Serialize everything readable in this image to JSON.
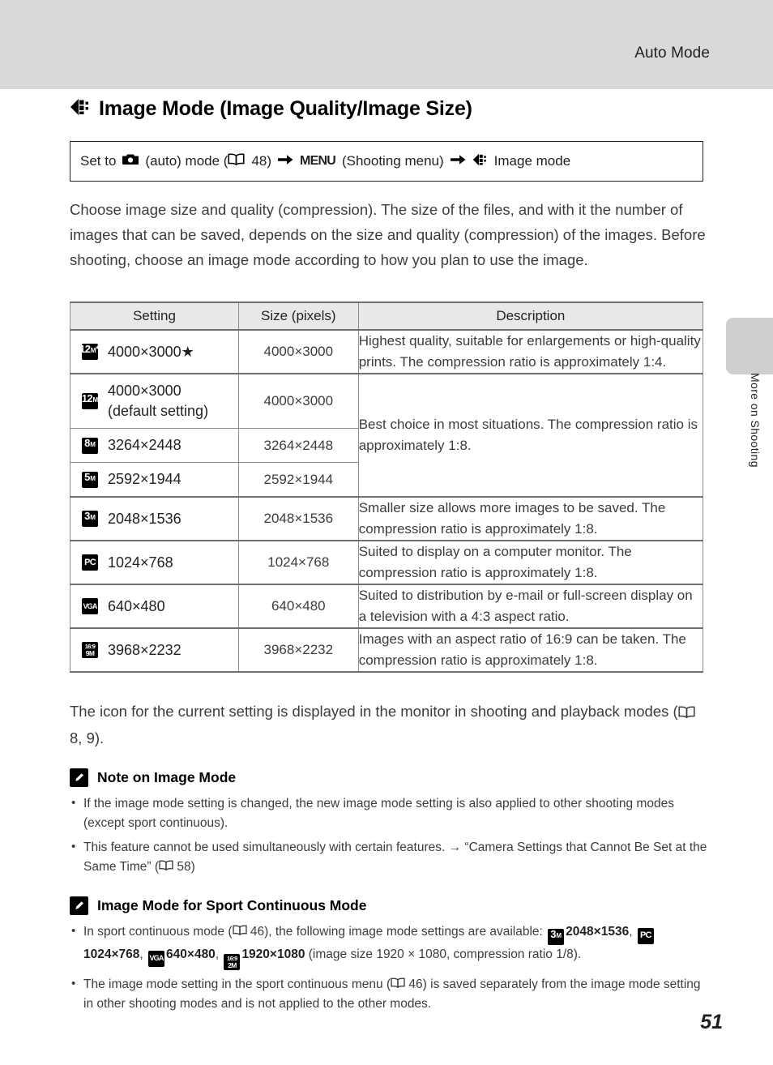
{
  "header": {
    "running_title": "Auto Mode"
  },
  "side_tab": {
    "label": "More on Shooting"
  },
  "section": {
    "icon": "image-mode-icon",
    "title": "Image Mode (Image Quality/Image Size)"
  },
  "route": {
    "set_to": "Set to",
    "camera_icon": "camera-auto-icon",
    "auto_mode": "(auto) mode (",
    "book_icon": "book-reference-icon",
    "page_ref_1": "48)",
    "arrow1": "➔",
    "menu": "MENU",
    "shooting_menu": "(Shooting menu)",
    "arrow2": "➔",
    "image_mode_icon": "image-mode-icon",
    "image_mode": "Image mode"
  },
  "intro": "Choose image size and quality (compression). The size of the files, and with it the number of images that can be saved, depends on the size and quality (compression) of the images. Before shooting, choose an image mode according to how you plan to use the image.",
  "table": {
    "headers": [
      "Setting",
      "Size (pixels)",
      "Description"
    ],
    "rows": [
      {
        "icon": "12m-fine-icon",
        "icon_big": "12",
        "icon_small": "M",
        "icon_star": "★",
        "setting": "4000×3000★",
        "size": "4000×3000",
        "description": "Highest quality, suitable for enlargements or high-quality prints. The compression ratio is approximately 1:4."
      },
      {
        "icon": "12m-normal-icon",
        "icon_big": "12",
        "icon_small": "M",
        "icon_star": "",
        "setting": "4000×3000 (default setting)",
        "setting_line1": "4000×3000",
        "setting_line2": "(default setting)",
        "size": "4000×3000",
        "description": "Best choice in most situations. The compression ratio is approximately 1:8."
      },
      {
        "icon": "8m-icon",
        "icon_big": "8",
        "icon_small": "M",
        "icon_star": "",
        "setting": "3264×2448",
        "size": "3264×2448",
        "description": ""
      },
      {
        "icon": "5m-icon",
        "icon_big": "5",
        "icon_small": "M",
        "icon_star": "",
        "setting": "2592×1944",
        "size": "2592×1944",
        "description": ""
      },
      {
        "icon": "3m-icon",
        "icon_big": "3",
        "icon_small": "M",
        "icon_star": "",
        "setting": "2048×1536",
        "size": "2048×1536",
        "description": "Smaller size allows more images to be saved. The compression ratio is approximately 1:8."
      },
      {
        "icon": "pc-icon",
        "icon_word": "PC",
        "setting": "1024×768",
        "size": "1024×768",
        "description": "Suited to display on a computer monitor. The compression ratio is approximately 1:8."
      },
      {
        "icon": "vga-icon",
        "icon_word": "VGA",
        "setting": "640×480",
        "size": "640×480",
        "description": "Suited to distribution by e-mail or full-screen display on a television with a 4:3 aspect ratio."
      },
      {
        "icon": "16to9-9m-icon",
        "icon_row1": "16:9",
        "icon_row2": "9M",
        "setting": "3968×2232",
        "size": "3968×2232",
        "description": "Images with an aspect ratio of 16:9 can be taken. The compression ratio is approximately 1:8."
      }
    ]
  },
  "after_table": {
    "text_before": "The icon for the current setting is displayed in the monitor in shooting and playback modes (",
    "book_icon": "book-reference-icon",
    "page_refs": "8, 9)."
  },
  "note_image_mode": {
    "icon": "pencil-note-icon",
    "title": "Note on Image Mode",
    "bullets": [
      "If the image mode setting is changed, the new image mode setting is also applied to other shooting modes (except sport continuous).",
      "This feature cannot be used simultaneously with certain features. → “Camera Settings that Cannot Be Set at the Same Time” ("
    ],
    "bullet2_page_ref": "58)"
  },
  "note_sport": {
    "icon": "pencil-note-icon",
    "title": "Image Mode for Sport Continuous Mode",
    "bullet1": {
      "part1": "In sport continuous mode (",
      "page_ref": "46)",
      "part2": ", the following image mode settings are available:",
      "items": [
        {
          "icon": "3m-icon",
          "icon_big": "3",
          "icon_small": "M",
          "label": "2048×1536"
        },
        {
          "icon": "pc-icon",
          "icon_word": "PC",
          "label": "1024×768"
        },
        {
          "icon": "vga-icon",
          "icon_word": "VGA",
          "label": "640×480"
        },
        {
          "icon": "16to9-2m-icon",
          "icon_row1": "16:9",
          "icon_row2": "2M",
          "label": "1920×1080"
        }
      ],
      "tail": "(image size 1920 × 1080, compression ratio 1/8)."
    },
    "bullet2": {
      "part1": "The image mode setting in the sport continuous menu (",
      "page_ref": "46)",
      "part2": " is saved separately from the image mode setting in other shooting modes and is not applied to the other modes."
    }
  },
  "page_number": "51"
}
